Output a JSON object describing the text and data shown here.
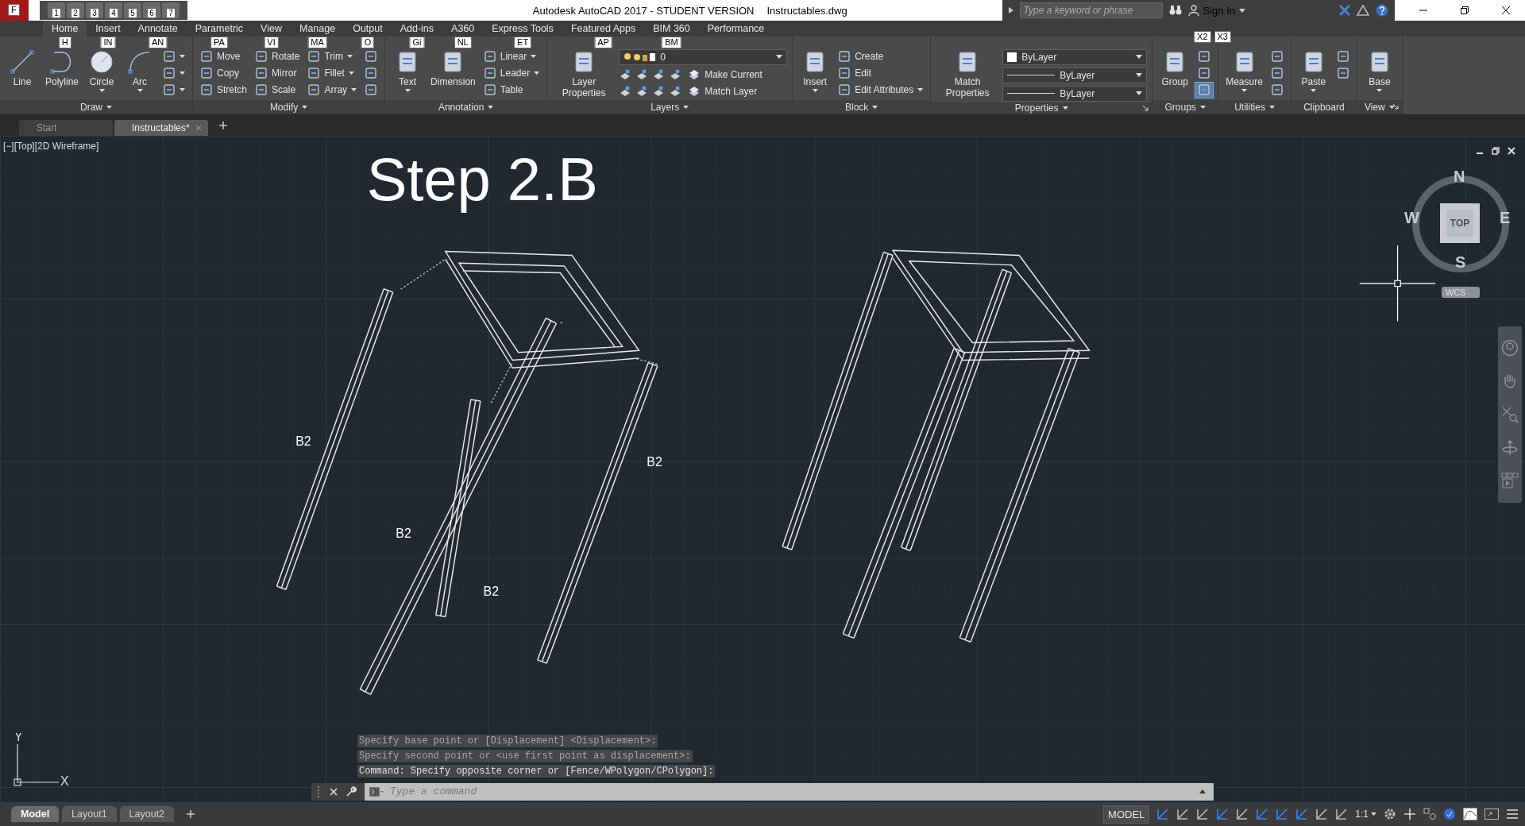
{
  "title_bar": {
    "app_keytip": "F",
    "quick_access_keytips": [
      "1",
      "2",
      "3",
      "4",
      "5",
      "6",
      "7"
    ],
    "title": "Autodesk AutoCAD 2017 - STUDENT VERSION",
    "file": "Instructables.dwg",
    "search_placeholder": "Type a keyword or phrase",
    "sign_in": "Sign In"
  },
  "ribbon_tabs": [
    {
      "label": "Home",
      "keytip": "H",
      "selected": true
    },
    {
      "label": "Insert",
      "keytip": "IN",
      "selected": false
    },
    {
      "label": "Annotate",
      "keytip": "AN",
      "selected": false
    },
    {
      "label": "Parametric",
      "keytip": "PA",
      "selected": false
    },
    {
      "label": "View",
      "keytip": "VI",
      "selected": false
    },
    {
      "label": "Manage",
      "keytip": "MA",
      "selected": false
    },
    {
      "label": "Output",
      "keytip": "O",
      "selected": false
    },
    {
      "label": "Add-ins",
      "keytip": "Gi",
      "selected": false
    },
    {
      "label": "A360",
      "keytip": "NL",
      "selected": false
    },
    {
      "label": "Express Tools",
      "keytip": "ET",
      "selected": false
    },
    {
      "label": "Featured Apps",
      "keytip": "AP",
      "selected": false
    },
    {
      "label": "BIM 360",
      "keytip": "BM",
      "selected": false
    },
    {
      "label": "Performance",
      "selected": false
    }
  ],
  "extra_keytips": [
    "X2",
    "X3"
  ],
  "panels": [
    {
      "title": "Draw",
      "menu": true,
      "launcher": false,
      "columns": [
        {
          "kind": "large",
          "label": "Line",
          "dropdown": false
        },
        {
          "kind": "large",
          "label": "Polyline",
          "dropdown": false
        },
        {
          "kind": "large",
          "label": "Circle",
          "dropdown": true
        },
        {
          "kind": "large",
          "label": "Arc",
          "dropdown": true
        },
        {
          "kind": "stack",
          "items": [
            {
              "dropdown": true
            },
            {
              "dropdown": true
            },
            {
              "dropdown": true
            }
          ]
        }
      ]
    },
    {
      "title": "Modify",
      "menu": true,
      "launcher": false,
      "columns": [
        {
          "kind": "stack",
          "items": [
            {
              "label": "Move",
              "dropdown": false
            },
            {
              "label": "Copy",
              "dropdown": false
            },
            {
              "label": "Stretch",
              "dropdown": false
            }
          ]
        },
        {
          "kind": "stack",
          "items": [
            {
              "label": "Rotate",
              "dropdown": false
            },
            {
              "label": "Mirror",
              "dropdown": false
            },
            {
              "label": "Scale",
              "dropdown": false
            }
          ]
        },
        {
          "kind": "stack",
          "items": [
            {
              "label": "Trim",
              "dropdown": true
            },
            {
              "label": "Fillet",
              "dropdown": true
            },
            {
              "label": "Array",
              "dropdown": true
            }
          ]
        },
        {
          "kind": "stack",
          "items": [
            {
              "dropdown": false
            },
            {
              "dropdown": false
            },
            {
              "dropdown": false
            }
          ]
        }
      ]
    },
    {
      "title": "Annotation",
      "menu": true,
      "launcher": false,
      "columns": [
        {
          "kind": "large",
          "label": "Text",
          "dropdown": true
        },
        {
          "kind": "large",
          "label": "Dimension",
          "dropdown": false
        },
        {
          "kind": "stack",
          "items": [
            {
              "label": "Linear",
              "dropdown": true
            },
            {
              "label": "Leader",
              "dropdown": true
            },
            {
              "label": "Table",
              "dropdown": false
            }
          ]
        }
      ]
    },
    {
      "title": "Layers",
      "menu": true,
      "launcher": false,
      "columns": [
        {
          "kind": "large",
          "label": "Layer Properties",
          "dropdown": false
        },
        {
          "kind": "layers",
          "combo": "0",
          "rows": [
            {
              "label": "Make Current"
            },
            {
              "label": "Match Layer"
            }
          ]
        }
      ]
    },
    {
      "title": "Block",
      "menu": true,
      "launcher": false,
      "columns": [
        {
          "kind": "large",
          "label": "Insert",
          "dropdown": true
        },
        {
          "kind": "stack",
          "items": [
            {
              "label": "Create",
              "dropdown": false
            },
            {
              "label": "Edit",
              "dropdown": false
            },
            {
              "label": "Edit Attributes",
              "dropdown": true
            }
          ]
        }
      ]
    },
    {
      "title": "Properties",
      "menu": true,
      "launcher": true,
      "columns": [
        {
          "kind": "large",
          "label": "Match Properties",
          "dropdown": false
        },
        {
          "kind": "combos",
          "items": [
            {
              "kind": "color",
              "value": "ByLayer"
            },
            {
              "kind": "linetype",
              "value": "ByLayer"
            },
            {
              "kind": "lineweight",
              "value": "ByLayer"
            }
          ]
        }
      ]
    },
    {
      "title": "Groups",
      "menu": true,
      "launcher": false,
      "columns": [
        {
          "kind": "large",
          "label": "Group",
          "dropdown": false
        },
        {
          "kind": "stack",
          "items": [
            {
              "dropdown": false,
              "on": false
            },
            {
              "dropdown": false,
              "on": false
            },
            {
              "dropdown": false,
              "on": true
            }
          ]
        }
      ]
    },
    {
      "title": "Utilities",
      "menu": true,
      "launcher": false,
      "columns": [
        {
          "kind": "large",
          "label": "Measure",
          "dropdown": true
        },
        {
          "kind": "stack",
          "items": [
            {
              "dropdown": false
            },
            {
              "dropdown": false
            },
            {
              "dropdown": false
            }
          ]
        }
      ]
    },
    {
      "title": "Clipboard",
      "menu": false,
      "launcher": false,
      "columns": [
        {
          "kind": "large",
          "label": "Paste",
          "dropdown": true
        },
        {
          "kind": "stack",
          "items": [
            {
              "dropdown": false
            },
            {
              "dropdown": false
            }
          ]
        }
      ]
    },
    {
      "title": "View",
      "menu": true,
      "launcher": true,
      "columns": [
        {
          "kind": "large",
          "label": "Base",
          "dropdown": true
        }
      ]
    }
  ],
  "document_tabs": [
    {
      "label": "Start",
      "selected": false
    },
    {
      "label": "Instructables*",
      "selected": true
    }
  ],
  "viewport": {
    "label": "[−][Top][2D Wireframe]",
    "heading": "Step 2.B",
    "part_labels": [
      "B2",
      "B2",
      "B2",
      "B2"
    ],
    "compass": {
      "north": "N",
      "east": "E",
      "south": "S",
      "west": "W",
      "face": "TOP"
    },
    "ucs_menu": "WCS",
    "axis_x": "X",
    "axis_y": "Y"
  },
  "command_history": [
    "Specify base point or [Displacement] <Displacement>:",
    "Specify second point or <use first point as displacement>:",
    "Command: Specify opposite corner or [Fence/WPolygon/CPolygon]:"
  ],
  "command_placeholder": "Type a command",
  "layout_tabs": [
    {
      "label": "Model",
      "selected": true
    },
    {
      "label": "Layout1",
      "selected": false
    },
    {
      "label": "Layout2",
      "selected": false
    }
  ],
  "status_bar": {
    "space": "MODEL",
    "scale": "1:1",
    "toggles": [
      {
        "on": true
      },
      {
        "on": false
      },
      {
        "on": false
      },
      {
        "on": true
      },
      {
        "on": false
      },
      {
        "on": true
      },
      {
        "on": true
      },
      {
        "on": true
      },
      {
        "on": false
      },
      {
        "on": false
      }
    ]
  }
}
